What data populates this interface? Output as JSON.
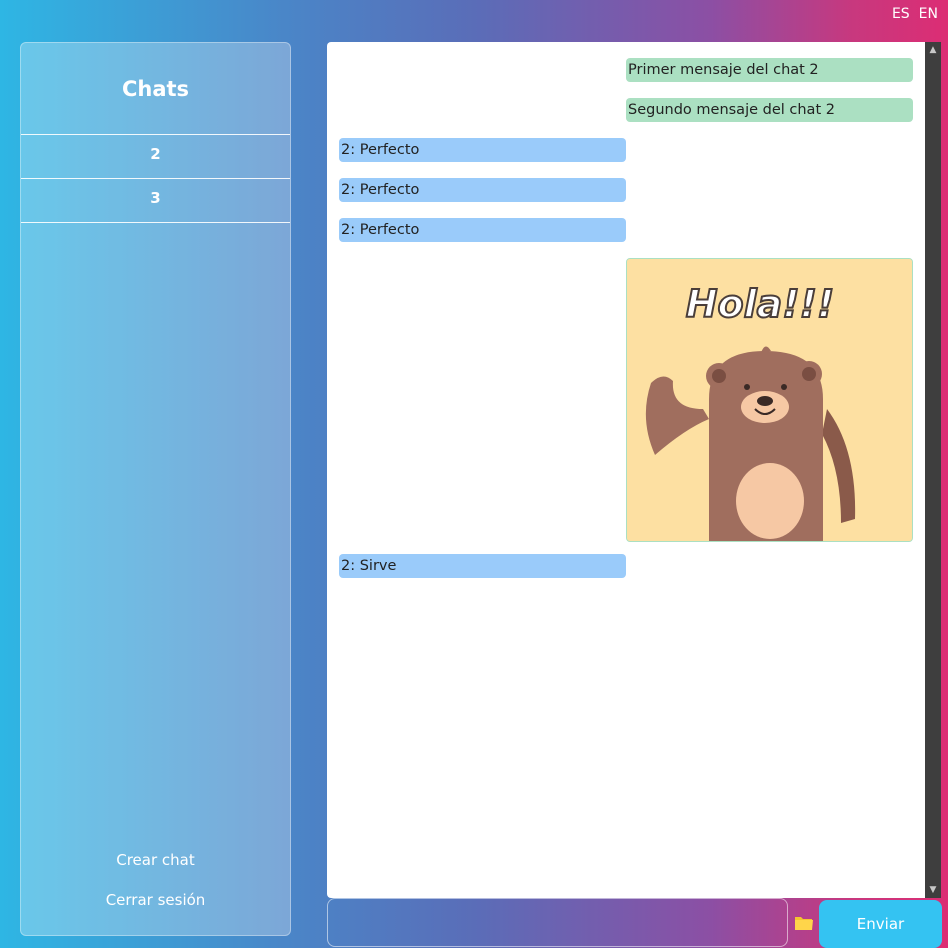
{
  "language": {
    "es_label": "ES",
    "en_label": "EN"
  },
  "sidebar": {
    "title": "Chats",
    "chats": [
      "2",
      "3"
    ],
    "create_chat_label": "Crear chat",
    "logout_label": "Cerrar sesión"
  },
  "messages": [
    {
      "text": "Primer mensaje del chat 2",
      "mine": true
    },
    {
      "text": "Segundo mensaje del chat 2",
      "mine": true
    },
    {
      "text": "2: Perfecto",
      "mine": false
    },
    {
      "text": "2: Perfecto",
      "mine": false
    },
    {
      "text": "2: Perfecto",
      "mine": false
    },
    {
      "sticker": true,
      "text": "Hola!!!",
      "mine": true
    },
    {
      "text": "2: Sirve",
      "mine": false
    }
  ],
  "composer": {
    "value": "",
    "placeholder": "",
    "attach_icon": "folder-icon",
    "send_label": "Enviar"
  },
  "colors": {
    "mine_bubble": "#abe0c2",
    "other_bubble": "#9acbfa",
    "send_button": "#34c3f2"
  }
}
